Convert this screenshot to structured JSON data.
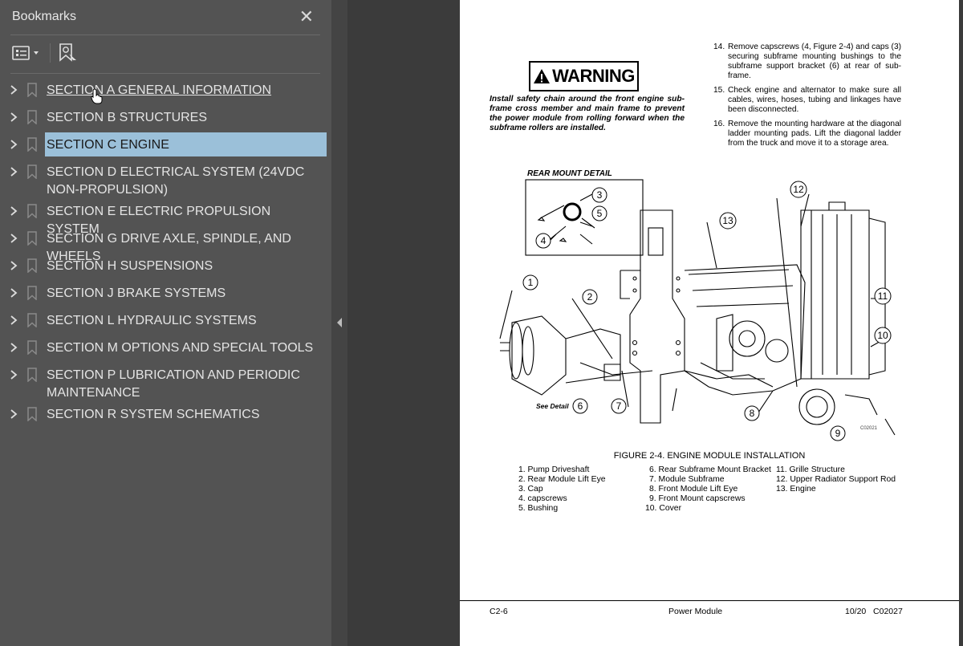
{
  "panel": {
    "title": "Bookmarks",
    "close_icon": "close-icon",
    "options_icon": "list-options-icon",
    "add_bookmark_icon": "bookmark-add-icon"
  },
  "bookmarks": [
    {
      "label": "SECTION A GENERAL INFORMATION",
      "state": "hover"
    },
    {
      "label": "SECTION B STRUCTURES"
    },
    {
      "label": "SECTION C ENGINE",
      "state": "selected"
    },
    {
      "label": "SECTION D ELECTRICAL SYSTEM (24VDC NON-PROPULSION)"
    },
    {
      "label": "SECTION E ELECTRIC PROPULSION SYSTEM"
    },
    {
      "label": "SECTION G DRIVE AXLE, SPINDLE, AND WHEELS"
    },
    {
      "label": "SECTION H SUSPENSIONS"
    },
    {
      "label": "SECTION J BRAKE SYSTEMS"
    },
    {
      "label": "SECTION L HYDRAULIC SYSTEMS"
    },
    {
      "label": "SECTION M OPTIONS AND SPECIAL TOOLS"
    },
    {
      "label": "SECTION P LUBRICATION AND PERIODIC MAINTENANCE"
    },
    {
      "label": "SECTION R SYSTEM SCHEMATICS"
    }
  ],
  "document": {
    "warning_title": "WARNING",
    "warning_text": "Install safety chain around the front engine sub-frame cross member and main frame to prevent the power module from rolling forward when the subframe rollers are installed.",
    "steps": [
      {
        "num": "14.",
        "text": "Remove capscrews (4, Figure 2-4) and caps (3) securing subframe mounting bushings to the subframe support bracket (6) at rear of sub-frame."
      },
      {
        "num": "15.",
        "text": "Check engine and alternator to make sure all cables, wires, hoses, tubing and linkages have been disconnected."
      },
      {
        "num": "16.",
        "text": "Remove the mounting hardware at the diagonal ladder mounting pads. Lift the diagonal ladder from the truck and move it to a storage area."
      }
    ],
    "detail_label": "REAR MOUNT DETAIL",
    "see_detail": "See Detail",
    "drawing_code": "C02021",
    "figure_caption": "FIGURE 2-4. ENGINE MODULE INSTALLATION",
    "legend_col1": [
      "1. Pump Driveshaft",
      "2. Rear Module Lift Eye",
      "3. Cap",
      "4. capscrews",
      "5. Bushing"
    ],
    "legend_col2": [
      "6. Rear Subframe Mount Bracket",
      "7. Module Subframe",
      "8. Front Module Lift Eye",
      "9. Front Mount capscrews",
      "10. Cover"
    ],
    "legend_col3": [
      "11. Grille Structure",
      "12. Upper Radiator Support Rod",
      "13. Engine"
    ],
    "callouts": [
      "1",
      "2",
      "3",
      "4",
      "5",
      "6",
      "7",
      "8",
      "9",
      "10",
      "11",
      "12",
      "13"
    ],
    "footer_left": "C2-6",
    "footer_center": "Power Module",
    "footer_right": "10/20   C02027"
  }
}
